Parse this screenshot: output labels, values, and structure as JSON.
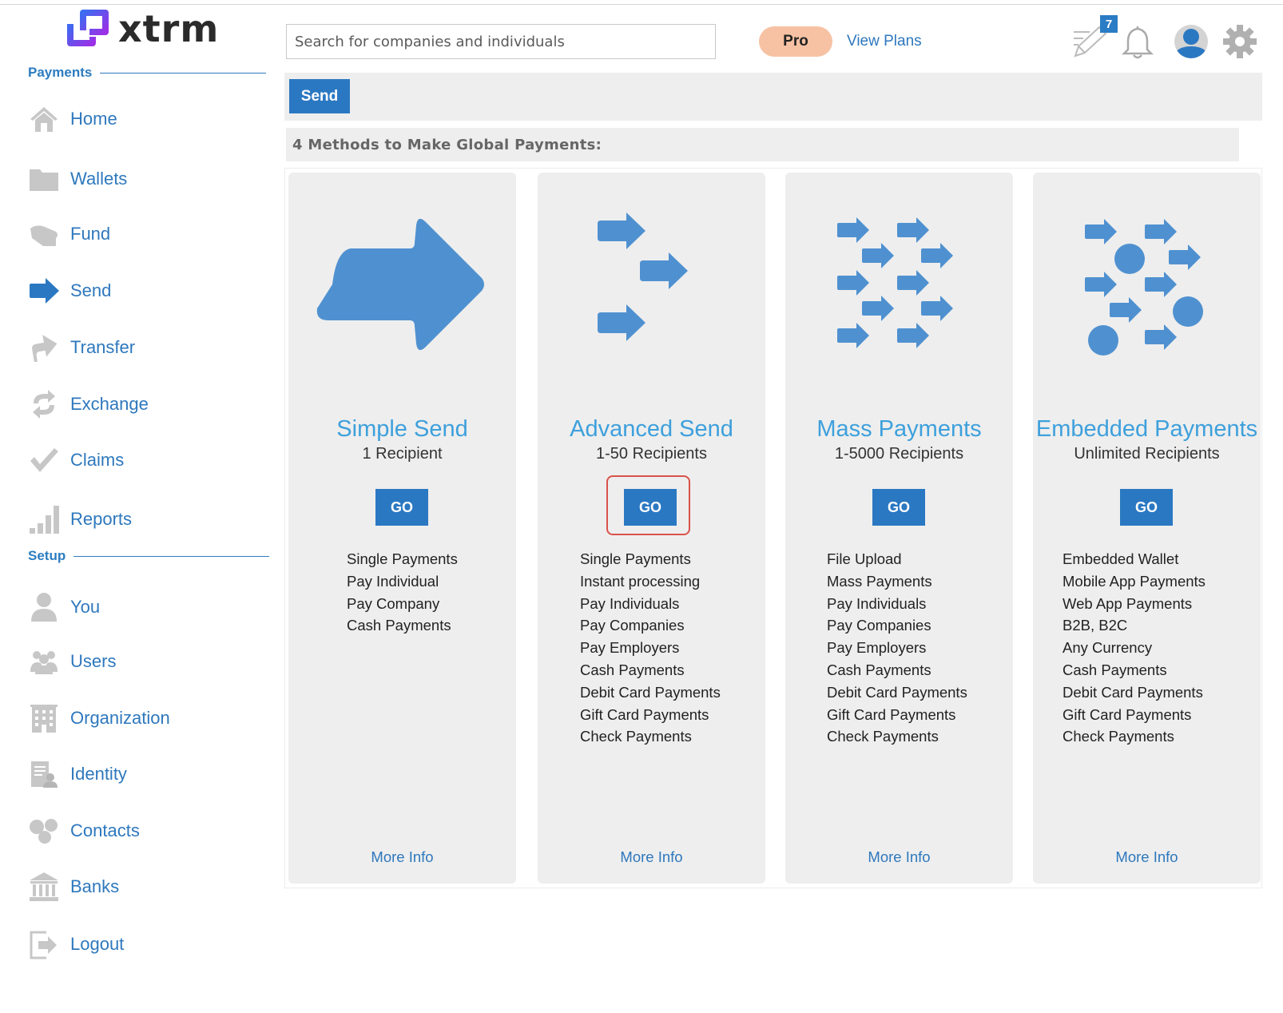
{
  "brand": {
    "name": "xtrm",
    "logo_icon": "xtrm-chain-logo",
    "accent": "#2e78bd",
    "logo_color": "#7b35e0"
  },
  "sidebar": {
    "sections": [
      {
        "title": "Payments",
        "items": [
          {
            "label": "Home",
            "icon": "home-icon"
          },
          {
            "label": "Wallets",
            "icon": "folder-icon"
          },
          {
            "label": "Fund",
            "icon": "hand-icon"
          },
          {
            "label": "Send",
            "icon": "arrow-right-icon",
            "active": true
          },
          {
            "label": "Transfer",
            "icon": "transfer-arrow-icon"
          },
          {
            "label": "Exchange",
            "icon": "exchange-icon"
          },
          {
            "label": "Claims",
            "icon": "checkmark-icon"
          },
          {
            "label": "Reports",
            "icon": "bar-chart-icon"
          }
        ]
      },
      {
        "title": "Setup",
        "items": [
          {
            "label": "You",
            "icon": "user-icon"
          },
          {
            "label": "Users",
            "icon": "users-icon"
          },
          {
            "label": "Organization",
            "icon": "building-icon"
          },
          {
            "label": "Identity",
            "icon": "id-card-icon"
          },
          {
            "label": "Contacts",
            "icon": "contacts-icon"
          },
          {
            "label": "Banks",
            "icon": "bank-icon"
          },
          {
            "label": "Logout",
            "icon": "logout-icon"
          }
        ]
      }
    ]
  },
  "header": {
    "search_placeholder": "Search for companies and individuals",
    "plan_badge": "Pro",
    "view_plans": "View Plans",
    "notes_count": "7",
    "icons": [
      "pencil-icon",
      "bell-icon",
      "avatar-icon",
      "gear-icon"
    ]
  },
  "toolbar": {
    "send_tab": "Send"
  },
  "main": {
    "heading": "4 Methods to Make Global Payments:",
    "cards": [
      {
        "title": "Simple Send",
        "subtitle": "1 Recipient",
        "go": "GO",
        "features": [
          "Single Payments",
          "Pay Individual",
          "Pay Company",
          "Cash Payments"
        ],
        "more": "More Info"
      },
      {
        "title": "Advanced Send",
        "subtitle": "1-50 Recipients",
        "go": "GO",
        "highlighted": true,
        "features": [
          "Single Payments",
          "Instant processing",
          "Pay Individuals",
          "Pay Companies",
          "Pay Employers",
          "Cash Payments",
          "Debit Card Payments",
          "Gift Card Payments",
          "Check Payments"
        ],
        "more": "More Info"
      },
      {
        "title": "Mass Payments",
        "subtitle": "1-5000 Recipients",
        "go": "GO",
        "features": [
          "File Upload",
          "Mass Payments",
          "Pay Individuals",
          "Pay Companies",
          "Pay Employers",
          "Cash Payments",
          "Debit Card Payments",
          "Gift Card Payments",
          "Check Payments"
        ],
        "more": "More Info"
      },
      {
        "title": "Embedded Payments",
        "subtitle": "Unlimited Recipients",
        "go": "GO",
        "features": [
          "Embedded Wallet",
          "Mobile App Payments",
          "Web App Payments",
          "B2B, B2C",
          "Any Currency",
          "Cash Payments",
          "Debit Card Payments",
          "Gift Card Payments",
          "Check Payments"
        ],
        "more": "More Info"
      }
    ]
  }
}
